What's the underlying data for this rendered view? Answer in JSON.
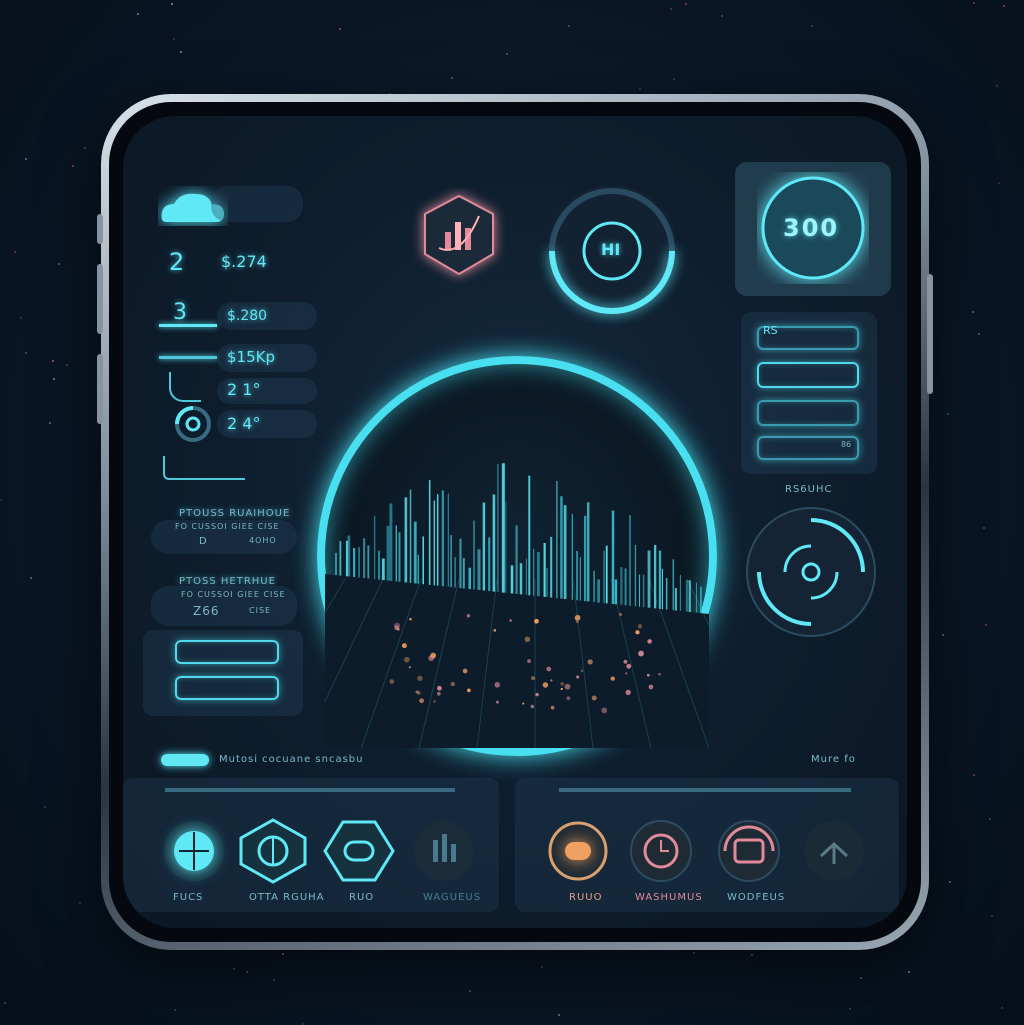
{
  "stats": [
    {
      "num": "2",
      "value": "$.274"
    },
    {
      "num": "3",
      "value": "$.280"
    },
    {
      "num": "",
      "value": "$15Kp"
    },
    {
      "num": "",
      "value": "2 1°"
    },
    {
      "num": "",
      "value": "2 4°"
    }
  ],
  "left_panels": [
    {
      "title": "PTOUSS RUAIHOUE",
      "line1": "FO CUSSOI GIEE CISE",
      "line2a": "D",
      "line2b": "4OHO"
    },
    {
      "title": "PTOSS HETRHUE",
      "line1": "FO CUSSOI GIEE CISE",
      "line2a": "Z66",
      "line2b": "CISE"
    }
  ],
  "top_icons": {
    "hex_label": "chart",
    "ring_label": "HI",
    "card_label": "300"
  },
  "right_list": {
    "header": "RS",
    "footer_num": "86",
    "caption": "RS6UHC"
  },
  "status_bar": {
    "left_text": "Mutosi cocuane sncasbu",
    "right_text": "Mure fo"
  },
  "dock_left": [
    {
      "name": "globe",
      "label": "FUCS"
    },
    {
      "name": "compass",
      "label": "OTTA RGUHA"
    },
    {
      "name": "link",
      "label": "RUO"
    },
    {
      "name": "bar-graph",
      "label": "WAGUEUS"
    }
  ],
  "dock_right": [
    {
      "name": "flame",
      "label": "RUUO"
    },
    {
      "name": "clock",
      "label": "WASHUMUS"
    },
    {
      "name": "camera",
      "label": "WODFEUS"
    },
    {
      "name": "satellite",
      "label": ""
    }
  ],
  "colors": {
    "accent": "#5fe8f5",
    "warm": "#f0a060",
    "pink": "#e08a9a"
  }
}
